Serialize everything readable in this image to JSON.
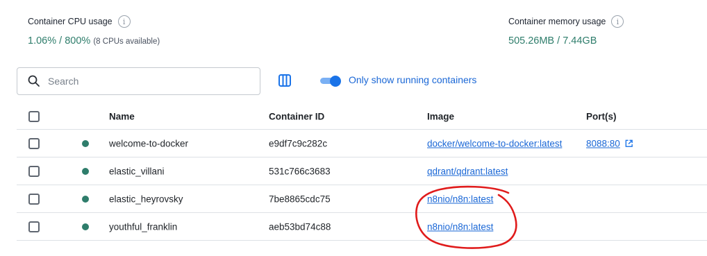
{
  "stats": {
    "cpu": {
      "label": "Container CPU usage",
      "value": "1.06%",
      "separator": " / ",
      "max": "800%",
      "note": "(8 CPUs available)"
    },
    "memory": {
      "label": "Container memory usage",
      "value": "505.26MB",
      "separator": " / ",
      "max": "7.44GB"
    },
    "info_icon": "info-icon"
  },
  "search": {
    "placeholder": "Search",
    "value": "",
    "icon": "search-icon"
  },
  "columns_icon": "columns-icon",
  "toggle": {
    "label": "Only show running containers",
    "on": true
  },
  "table": {
    "headers": {
      "name": "Name",
      "id": "Container ID",
      "image": "Image",
      "ports": "Port(s)"
    },
    "rows": [
      {
        "name": "welcome-to-docker",
        "id": "e9df7c9c282c",
        "image": "docker/welcome-to-docker:latest",
        "ports": "8088:80",
        "status": "running"
      },
      {
        "name": "elastic_villani",
        "id": "531c766c3683",
        "image": "qdrant/qdrant:latest",
        "ports": "",
        "status": "running"
      },
      {
        "name": "elastic_heyrovsky",
        "id": "7be8865cdc75",
        "image": "n8nio/n8n:latest",
        "ports": "",
        "status": "running"
      },
      {
        "name": "youthful_franklin",
        "id": "aeb53bd74c88",
        "image": "n8nio/n8n:latest",
        "ports": "",
        "status": "running"
      }
    ]
  },
  "colors": {
    "accent": "#1a73e8",
    "running": "#2e7d6b",
    "annotation": "#e01b1b"
  }
}
